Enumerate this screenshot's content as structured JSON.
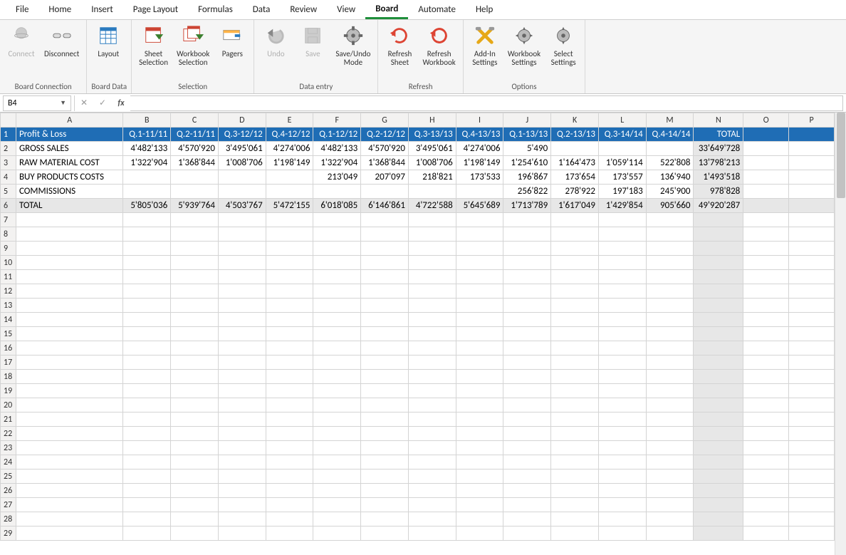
{
  "tabs": [
    "File",
    "Home",
    "Insert",
    "Page Layout",
    "Formulas",
    "Data",
    "Review",
    "View",
    "Board",
    "Automate",
    "Help"
  ],
  "active_tab": "Board",
  "ribbon": {
    "groups": [
      {
        "label": "Board Connection",
        "items": [
          {
            "id": "connect",
            "label": "Connect",
            "disabled": true
          },
          {
            "id": "disconnect",
            "label": "Disconnect",
            "disabled": false
          }
        ]
      },
      {
        "label": "Board Data",
        "items": [
          {
            "id": "layout",
            "label": "Layout"
          }
        ]
      },
      {
        "label": "Selection",
        "items": [
          {
            "id": "sheet-sel",
            "label": "Sheet\nSelection"
          },
          {
            "id": "wb-sel",
            "label": "Workbook\nSelection"
          },
          {
            "id": "pagers",
            "label": "Pagers"
          }
        ]
      },
      {
        "label": "Data entry",
        "items": [
          {
            "id": "undo",
            "label": "Undo",
            "disabled": true
          },
          {
            "id": "save",
            "label": "Save",
            "disabled": true
          },
          {
            "id": "su-mode",
            "label": "Save/Undo\nMode"
          }
        ]
      },
      {
        "label": "Refresh",
        "items": [
          {
            "id": "ref-sheet",
            "label": "Refresh\nSheet"
          },
          {
            "id": "ref-wb",
            "label": "Refresh\nWorkbook"
          }
        ]
      },
      {
        "label": "Options",
        "items": [
          {
            "id": "addin-set",
            "label": "Add-In\nSettings"
          },
          {
            "id": "wb-set",
            "label": "Workbook\nSettings"
          },
          {
            "id": "sel-set",
            "label": "Select\nSettings"
          }
        ]
      }
    ]
  },
  "namebox": "B4",
  "columns": [
    "A",
    "B",
    "C",
    "D",
    "E",
    "F",
    "G",
    "H",
    "I",
    "J",
    "K",
    "L",
    "M",
    "N",
    "O",
    "P"
  ],
  "header_row": [
    "Profit & Loss",
    "Q.1-11/11",
    "Q.2-11/11",
    "Q.3-12/12",
    "Q.4-12/12",
    "Q.1-12/12",
    "Q.2-12/12",
    "Q.3-13/13",
    "Q.4-13/13",
    "Q.1-13/13",
    "Q.2-13/13",
    "Q.3-14/14",
    "Q.4-14/14",
    "TOTAL"
  ],
  "data_rows": [
    {
      "label": "GROSS SALES",
      "vals": [
        "4'482'133",
        "4'570'920",
        "3'495'061",
        "4'274'006",
        "4'482'133",
        "4'570'920",
        "3'495'061",
        "4'274'006",
        "5'490",
        "",
        "",
        "",
        ""
      ],
      "total": "33'649'728"
    },
    {
      "label": "RAW MATERIAL COST",
      "vals": [
        "1'322'904",
        "1'368'844",
        "1'008'706",
        "1'198'149",
        "1'322'904",
        "1'368'844",
        "1'008'706",
        "1'198'149",
        "1'254'610",
        "1'164'473",
        "1'059'114",
        "522'808",
        ""
      ],
      "total": "13'798'213"
    },
    {
      "label": "BUY PRODUCTS COSTS",
      "vals": [
        "",
        "",
        "",
        "",
        "213'049",
        "207'097",
        "218'821",
        "173'533",
        "196'867",
        "173'654",
        "173'557",
        "136'940",
        ""
      ],
      "total": "1'493'518"
    },
    {
      "label": "COMMISSIONS",
      "vals": [
        "",
        "",
        "",
        "",
        "",
        "",
        "",
        "",
        "256'822",
        "278'922",
        "197'183",
        "245'900",
        ""
      ],
      "total": "978'828"
    }
  ],
  "total_row": {
    "label": "TOTAL",
    "vals": [
      "5'805'036",
      "5'939'764",
      "4'503'767",
      "5'472'155",
      "6'018'085",
      "6'146'861",
      "4'722'588",
      "5'645'689",
      "1'713'789",
      "1'617'049",
      "1'429'854",
      "905'660",
      ""
    ],
    "total": "49'920'287"
  },
  "empty_rows_after": 23
}
